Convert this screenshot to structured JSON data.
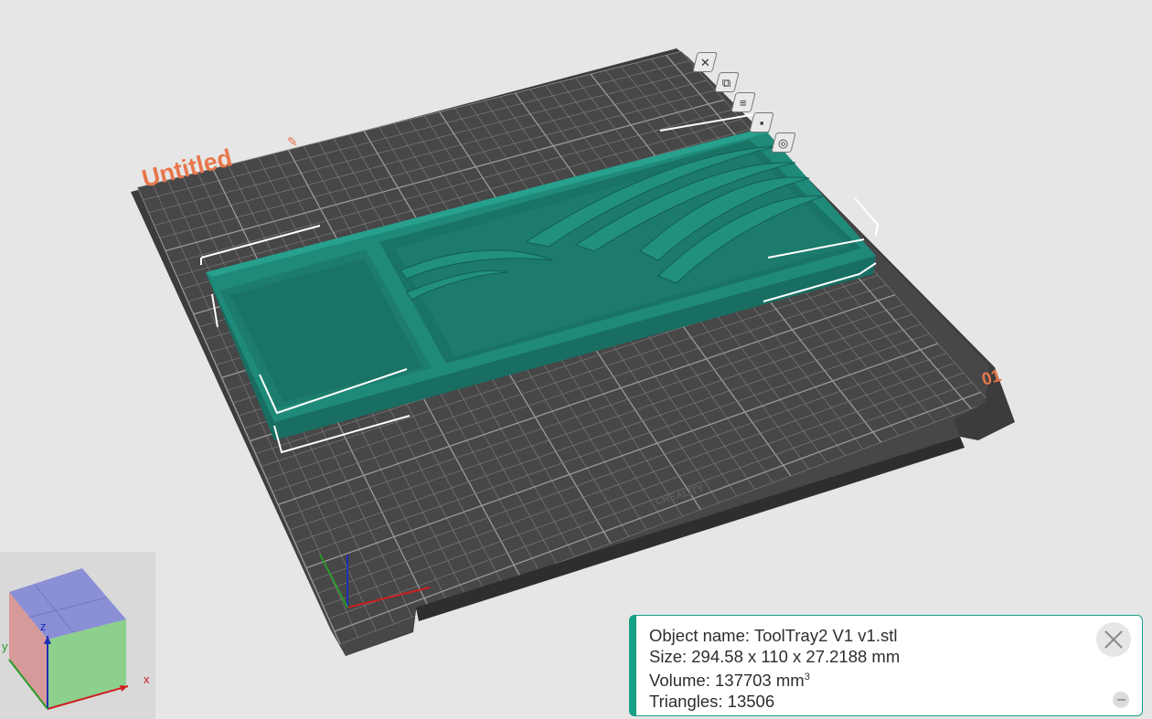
{
  "plate": {
    "name_label": "Untitled",
    "number_label": "01",
    "brand_logo": "CREALITY"
  },
  "plate_tools": [
    {
      "name": "delete-plate-icon",
      "glyph": "✕"
    },
    {
      "name": "arrange-icon",
      "glyph": "⧉"
    },
    {
      "name": "plate-settings-icon",
      "glyph": "≡"
    },
    {
      "name": "lock-plate-icon",
      "glyph": "▪"
    },
    {
      "name": "camera-icon",
      "glyph": "◎"
    }
  ],
  "object_info": {
    "name_line": "Object name: ToolTray2 V1 v1.stl",
    "size_line": "Size: 294.58 x 110 x 27.2188 mm",
    "volume_line_prefix": "Volume: 137703 mm",
    "volume_unit_sup": "3",
    "triangles_line": "Triangles: 13506"
  },
  "axes": {
    "x": "x",
    "y": "y",
    "z": "z"
  },
  "colors": {
    "background": "#e6e6e6",
    "plate": "#3d3d3d",
    "grid": "#8a8a8a",
    "model": "#1f8a7a",
    "accent": "#16a085",
    "label_orange": "#e8774d",
    "axis_x": "#cc1f1f",
    "axis_y": "#2a9a2a",
    "axis_z": "#1f2fb3"
  }
}
